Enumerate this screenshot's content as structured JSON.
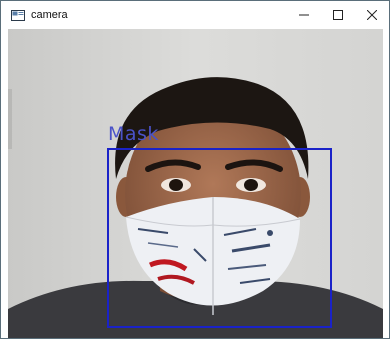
{
  "window": {
    "title": "camera",
    "icon": "app-window-icon",
    "controls": [
      "minimize-icon",
      "maximize-icon",
      "close-icon"
    ]
  },
  "detection": {
    "label": "Mask",
    "box_color": "#1a22c8",
    "label_color": "#4a52c8"
  },
  "colors": {
    "background": "#d8d8d6",
    "skin": "#a06a4c",
    "hair": "#1c1612",
    "shirt": "#3a3a3e",
    "mask": "#eef0f4"
  }
}
